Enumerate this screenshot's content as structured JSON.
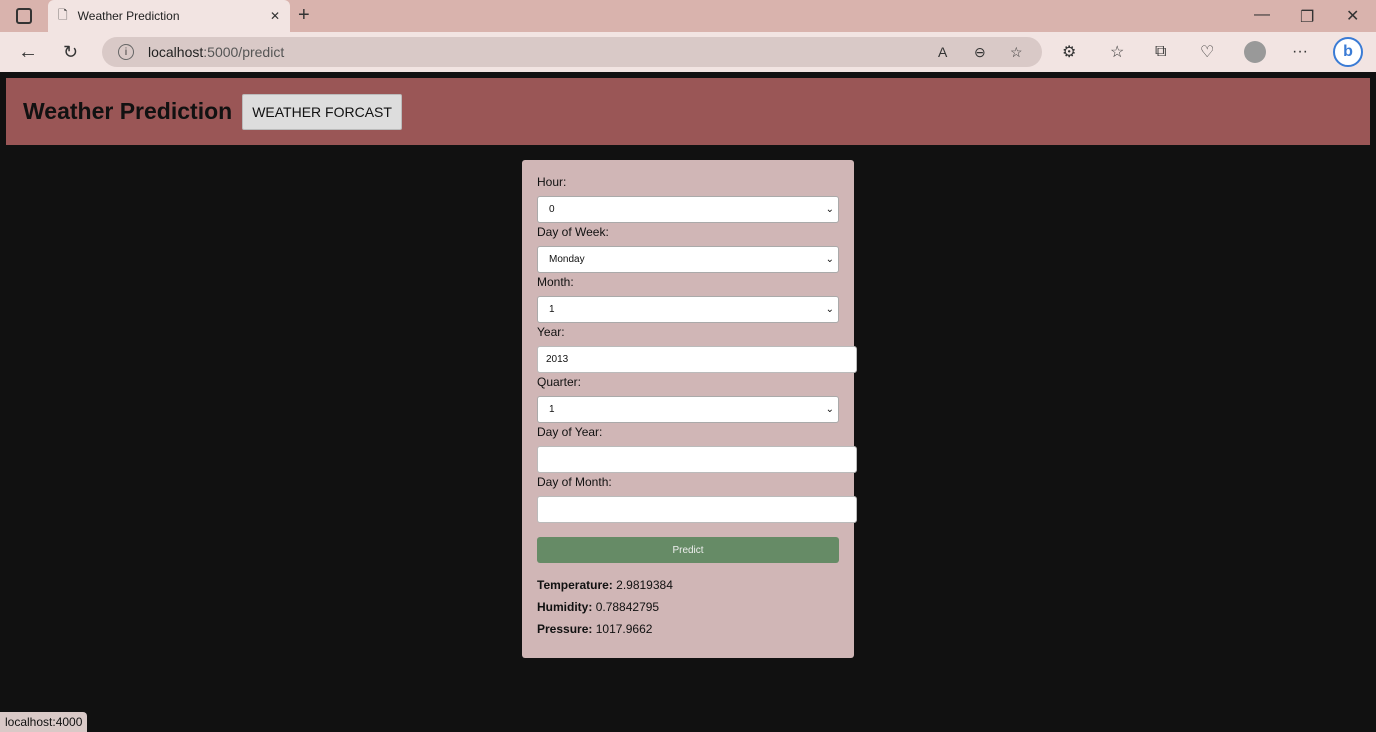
{
  "browser": {
    "tab_title": "Weather Prediction",
    "url_host": "localhost",
    "url_path": ":5000/predict",
    "status_url": "localhost:4000"
  },
  "header": {
    "title": "Weather Prediction",
    "button": "WEATHER FORCAST"
  },
  "form": {
    "hour": {
      "label": "Hour:",
      "value": "0"
    },
    "day_of_week": {
      "label": "Day of Week:",
      "value": "Monday"
    },
    "month": {
      "label": "Month:",
      "value": "1"
    },
    "year": {
      "label": "Year:",
      "value": "2013"
    },
    "quarter": {
      "label": "Quarter:",
      "value": "1"
    },
    "day_of_year": {
      "label": "Day of Year:",
      "value": ""
    },
    "day_of_month": {
      "label": "Day of Month:",
      "value": ""
    },
    "predict": "Predict"
  },
  "results": [
    {
      "label": "Temperature:",
      "value": "2.9819384"
    },
    {
      "label": "Humidity:",
      "value": "0.78842795"
    },
    {
      "label": "Pressure:",
      "value": "1017.9662"
    }
  ]
}
